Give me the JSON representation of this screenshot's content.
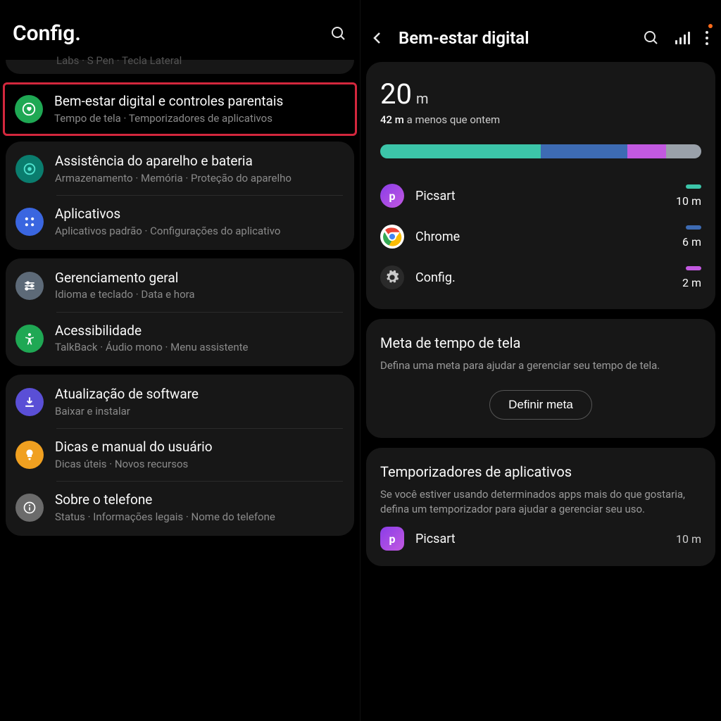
{
  "left": {
    "title": "Config.",
    "truncated_item_sub": "Labs  ·  S Pen  ·  Tecla Lateral",
    "highlighted": {
      "title": "Bem-estar digital e controles parentais",
      "sub": "Tempo de tela  ·  Temporizadores de aplicativos",
      "icon_bg": "#1fa854",
      "icon_name": "heart-shield-icon"
    },
    "group1": [
      {
        "title": "Assistência do aparelho e bateria",
        "sub": "Armazenamento  ·  Memória  ·  Proteção do aparelho",
        "icon_bg": "#0a7d6e",
        "icon_name": "device-care-icon"
      },
      {
        "title": "Aplicativos",
        "sub": "Aplicativos padrão  ·  Configurações do aplicativo",
        "icon_bg": "#3a66e0",
        "icon_name": "apps-grid-icon"
      }
    ],
    "group2": [
      {
        "title": "Gerenciamento geral",
        "sub": "Idioma e teclado  ·  Data e hora",
        "icon_bg": "#5d6a78",
        "icon_name": "sliders-icon"
      },
      {
        "title": "Acessibilidade",
        "sub": "TalkBack  ·  Áudio mono  ·  Menu assistente",
        "icon_bg": "#1fa854",
        "icon_name": "accessibility-icon"
      }
    ],
    "group3": [
      {
        "title": "Atualização de software",
        "sub": "Baixar e instalar",
        "icon_bg": "#5a4fd6",
        "icon_name": "download-icon"
      },
      {
        "title": "Dicas e manual do usuário",
        "sub": "Dicas úteis  ·  Novos recursos",
        "icon_bg": "#f0a020",
        "icon_name": "lightbulb-icon"
      },
      {
        "title": "Sobre o telefone",
        "sub": "Status  ·  Informações legais  ·  Nome do telefone",
        "icon_bg": "#6b6b6b",
        "icon_name": "info-icon"
      }
    ]
  },
  "right": {
    "title": "Bem-estar digital",
    "total_time_value": "20",
    "total_time_unit": "m",
    "compare_emph": "42 m",
    "compare_rest": " a menos que ontem",
    "bar_segments": [
      {
        "color": "#3cc5a9",
        "pct": 50
      },
      {
        "color": "#3d6bb3",
        "pct": 27
      },
      {
        "color": "#c259e0",
        "pct": 12
      },
      {
        "color": "#9aa1aa",
        "pct": 11
      }
    ],
    "apps": [
      {
        "name": "Picsart",
        "time": "10 m",
        "color": "#3cc5a9",
        "icon_bg": "linear-gradient(135deg,#8a3de8,#c259e0)",
        "icon_letter": "p"
      },
      {
        "name": "Chrome",
        "time": "6 m",
        "color": "#3d6bb3",
        "icon_bg": "#fff",
        "icon_svg": "chrome"
      },
      {
        "name": "Config.",
        "time": "2 m",
        "color": "#c259e0",
        "icon_bg": "#2a2a2a",
        "icon_svg": "gear"
      }
    ],
    "goal": {
      "title": "Meta de tempo de tela",
      "desc": "Defina uma meta para ajudar a gerenciar seu tempo de tela.",
      "button": "Definir meta"
    },
    "timers": {
      "title": "Temporizadores de aplicativos",
      "desc": "Se você estiver usando determinados apps mais do que gostaria, defina um temporizador para ajudar a gerenciar seu uso.",
      "app": {
        "name": "Picsart",
        "time": "10 m",
        "icon_bg": "linear-gradient(135deg,#8a3de8,#c259e0)",
        "icon_letter": "p"
      }
    }
  }
}
